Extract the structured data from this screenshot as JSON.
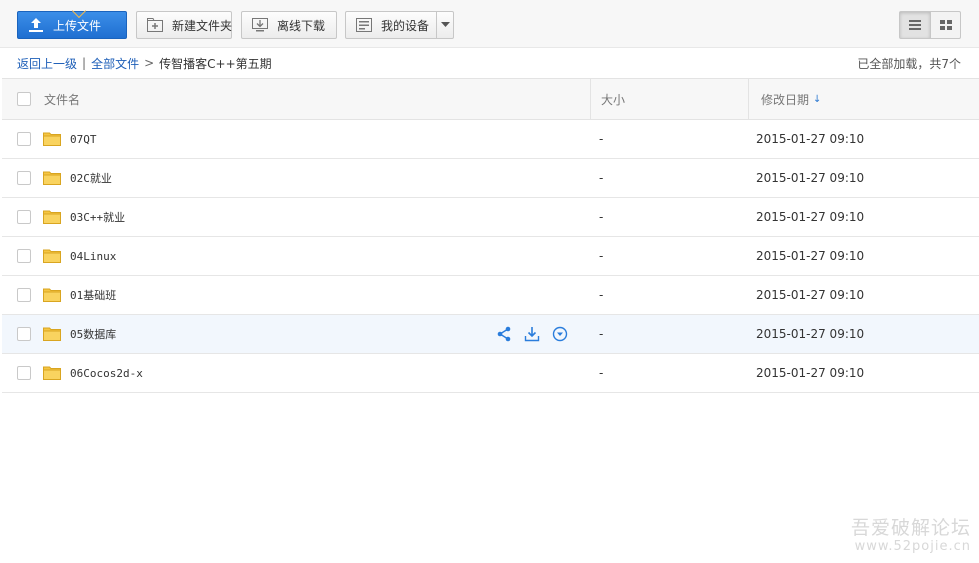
{
  "toolbar": {
    "upload_label": "上传文件",
    "new_folder_label": "新建文件夹",
    "offline_download_label": "离线下载",
    "my_devices_label": "我的设备",
    "upload_icon": "upload-icon",
    "new_folder_icon": "new-folder-icon",
    "offline_download_icon": "offline-download-icon",
    "devices_icon": "device-icon",
    "view_modes": [
      "list",
      "grid"
    ],
    "active_view": "list",
    "accent": "#2a7ddc"
  },
  "breadcrumb": {
    "back": "返回上一级",
    "separator": "|",
    "root": "全部文件",
    "arrow": ">",
    "current": "传智播客C++第五期",
    "status": "已全部加载，共7个"
  },
  "table": {
    "headers": {
      "name": "文件名",
      "size": "大小",
      "modified": "修改日期",
      "sort_indicator": "↓"
    },
    "rows": [
      {
        "name": "07QT",
        "size": "-",
        "modified": "2015-01-27 09:10",
        "hover": false
      },
      {
        "name": "02C就业",
        "size": "-",
        "modified": "2015-01-27 09:10",
        "hover": false
      },
      {
        "name": "03C++就业",
        "size": "-",
        "modified": "2015-01-27 09:10",
        "hover": false
      },
      {
        "name": "04Linux",
        "size": "-",
        "modified": "2015-01-27 09:10",
        "hover": false
      },
      {
        "name": "01基础班",
        "size": "-",
        "modified": "2015-01-27 09:10",
        "hover": false
      },
      {
        "name": "05数据库",
        "size": "-",
        "modified": "2015-01-27 09:10",
        "hover": true
      },
      {
        "name": "06Cocos2d-x",
        "size": "-",
        "modified": "2015-01-27 09:10",
        "hover": false
      }
    ],
    "row_action_icons": [
      "share-icon",
      "download-icon",
      "more-icon"
    ]
  },
  "watermark": {
    "line1": "吾爱破解论坛",
    "line2": "www.52pojie.cn"
  }
}
